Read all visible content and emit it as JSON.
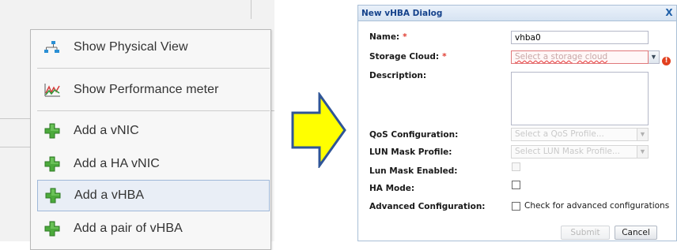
{
  "context_menu": {
    "items": [
      {
        "label": "Show Physical View",
        "icon": "physical-view-icon"
      },
      {
        "label": "Show Performance meter",
        "icon": "performance-meter-icon"
      },
      {
        "label": "Add a vNIC",
        "icon": "green-plus-icon"
      },
      {
        "label": "Add a HA vNIC",
        "icon": "green-plus-icon"
      },
      {
        "label": "Add a vHBA",
        "icon": "green-plus-icon",
        "selected": true
      },
      {
        "label": "Add a pair of vHBA",
        "icon": "green-plus-icon"
      }
    ]
  },
  "arrow": {
    "color": "#ffff00",
    "outline": "#2f5597"
  },
  "dialog": {
    "title": "New vHBA Dialog",
    "close_glyph": "X",
    "fields": {
      "name": {
        "label": "Name:",
        "required_mark": "*",
        "value": "vhba0"
      },
      "storage_cloud": {
        "label": "Storage Cloud:",
        "required_mark": "*",
        "placeholder": "Select a storage cloud",
        "error_glyph": "!"
      },
      "description": {
        "label": "Description:",
        "value": ""
      },
      "qos": {
        "label": "QoS Configuration:",
        "placeholder": "Select a QoS Profile..."
      },
      "lun_mask_profile": {
        "label": "LUN Mask Profile:",
        "placeholder": "Select LUN Mask Profile..."
      },
      "lun_mask_enabled": {
        "label": "Lun Mask Enabled:",
        "checked": false,
        "disabled": true
      },
      "ha_mode": {
        "label": "HA Mode:",
        "checked": false
      },
      "advanced": {
        "label": "Advanced Configuration:",
        "checkbox_text": "Check for advanced configurations",
        "checked": false
      }
    },
    "buttons": {
      "submit": "Submit",
      "cancel": "Cancel"
    }
  }
}
